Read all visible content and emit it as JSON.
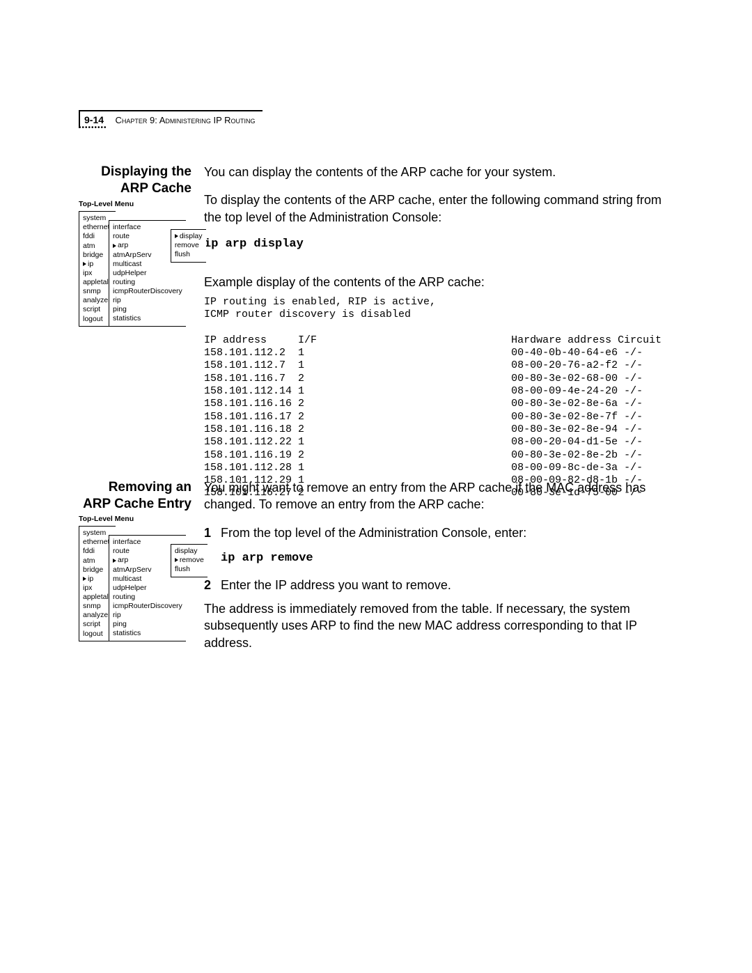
{
  "header": {
    "page_number": "9-14",
    "chapter_label": "Chapter 9: Administering IP Routing"
  },
  "section1": {
    "heading": "Displaying the ARP Cache",
    "p1": "You can display the contents of the ARP cache for your system.",
    "p2": "To display the contents of the ARP cache, enter the following command string from the top level of the Administration Console:",
    "cmd": "ip arp display",
    "p3": "Example display of the contents of the ARP cache:",
    "output": "IP routing is enabled, RIP is active,\nICMP router discovery is disabled\n\nIP address     I/F                               Hardware address Circuit\n158.101.112.2  1                                 00-40-0b-40-64-e6 -/-\n158.101.112.7  1                                 08-00-20-76-a2-f2 -/-\n158.101.116.7  2                                 00-80-3e-02-68-00 -/-\n158.101.112.14 1                                 08-00-09-4e-24-20 -/-\n158.101.116.16 2                                 00-80-3e-02-8e-6a -/-\n158.101.116.17 2                                 00-80-3e-02-8e-7f -/-\n158.101.116.18 2                                 00-80-3e-02-8e-94 -/-\n158.101.112.22 1                                 08-00-20-04-d1-5e -/-\n158.101.116.19 2                                 00-80-3e-02-8e-2b -/-\n158.101.112.28 1                                 08-00-09-8c-de-3a -/-\n158.101.112.29 1                                 08-00-09-82-d8-1b -/-\n158.101.116.27 2                                 00-80-3e-1d-75-00 -/-"
  },
  "menu1": {
    "title": "Top-Level Menu",
    "col1": [
      "system",
      "ethernet",
      "fddi",
      "atm",
      "bridge",
      "ip",
      "ipx",
      "appletalk",
      "snmp",
      "analyzer",
      "script",
      "logout"
    ],
    "col1_active_index": 5,
    "col2": [
      "interface",
      "route",
      "arp",
      "atmArpServ",
      "multicast",
      "udpHelper",
      "routing",
      "icmpRouterDiscovery",
      "rip",
      "ping",
      "statistics"
    ],
    "col2_active_index": 2,
    "col3": [
      "display",
      "remove",
      "flush"
    ],
    "col3_active_index": 0
  },
  "section2": {
    "heading": "Removing an ARP Cache Entry",
    "p1": "You might want to remove an entry from the ARP cache if the MAC address has changed. To remove an entry from the ARP cache:",
    "step1": "From the top level of the Administration Console, enter:",
    "cmd": "ip arp remove",
    "step2a": "Enter the IP address you want to remove.",
    "step2b": "The address is immediately removed from the table. If necessary, the system subsequently uses ARP to find the new MAC address corresponding to that IP address."
  },
  "menu2": {
    "title": "Top-Level Menu",
    "col1": [
      "system",
      "ethernet",
      "fddi",
      "atm",
      "bridge",
      "ip",
      "ipx",
      "appletalk",
      "snmp",
      "analyzer",
      "script",
      "logout"
    ],
    "col1_active_index": 5,
    "col2": [
      "interface",
      "route",
      "arp",
      "atmArpServ",
      "multicast",
      "udpHelper",
      "routing",
      "icmpRouterDiscovery",
      "rip",
      "ping",
      "statistics"
    ],
    "col2_active_index": 2,
    "col3": [
      "display",
      "remove",
      "flush"
    ],
    "col3_active_index": 1
  }
}
